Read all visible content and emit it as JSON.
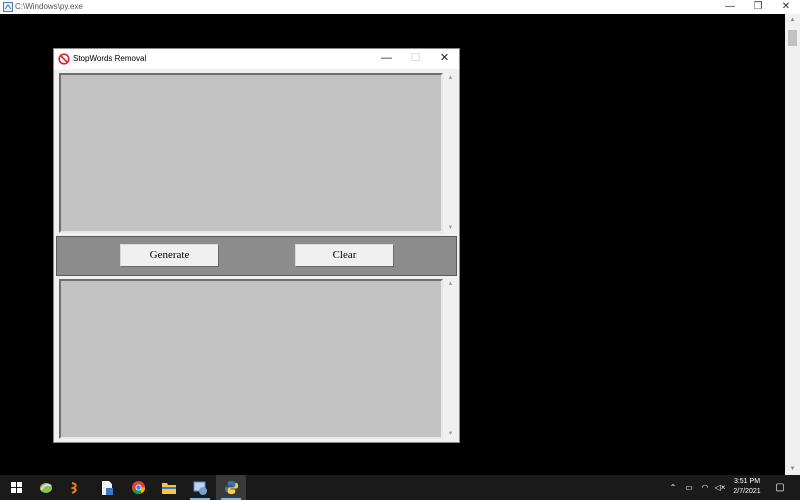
{
  "console": {
    "title": "C:\\Windows\\py.exe",
    "controls": {
      "minimize": "—",
      "restore": "❐",
      "close": "✕"
    }
  },
  "app": {
    "title": "StopWords Removal",
    "controls": {
      "minimize": "—",
      "maximize": "☐",
      "close": "✕"
    },
    "input_text": "",
    "output_text": "",
    "buttons": {
      "generate": "Generate",
      "clear": "Clear"
    }
  },
  "taskbar": {
    "pinned": [
      "windows-start",
      "app-swirl",
      "app-orange",
      "file-document",
      "chrome",
      "file-explorer",
      "app-system",
      "python"
    ],
    "tray": {
      "chevron": "⌃",
      "battery": "▭",
      "wifi": "◠",
      "volume": "◁×",
      "notification": "▢"
    },
    "clock": {
      "time": "3:51 PM",
      "date": "2/7/2021"
    }
  },
  "colors": {
    "text_area_bg": "#c3c3c3",
    "button_bar_bg": "#8c8c8c",
    "desktop_bg": "#000000",
    "taskbar_bg": "#1a1a1a"
  }
}
